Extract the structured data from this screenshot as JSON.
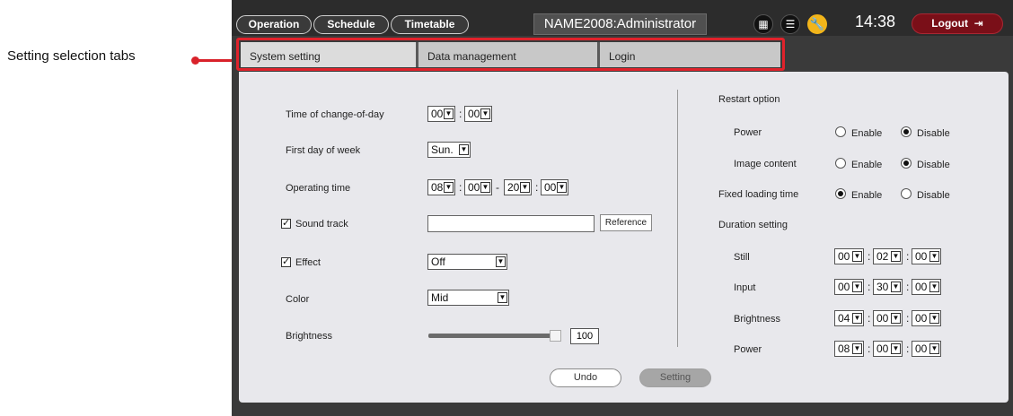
{
  "annotation": "Setting selection tabs",
  "nav": {
    "operation": "Operation",
    "schedule": "Schedule",
    "timetable": "Timetable"
  },
  "session_label": "NAME2008:Administrator",
  "clock": "14:38",
  "logout_label": "Logout",
  "tabs": [
    {
      "label": "System setting",
      "active": true
    },
    {
      "label": "Data management",
      "active": false
    },
    {
      "label": "Login",
      "active": false
    }
  ],
  "left": {
    "change_of_day": {
      "label": "Time of change-of-day",
      "hour": "00",
      "minute": "00"
    },
    "first_day": {
      "label": "First day of week",
      "value": "Sun."
    },
    "operating_time": {
      "label": "Operating time",
      "start_h": "08",
      "start_m": "00",
      "dash": "-",
      "end_h": "20",
      "end_m": "00"
    },
    "sound_track": {
      "label": "Sound track",
      "checked": true,
      "value": "",
      "reference_label": "Reference"
    },
    "effect": {
      "label": "Effect",
      "checked": true,
      "value": "Off"
    },
    "color": {
      "label": "Color",
      "value": "Mid"
    },
    "brightness": {
      "label": "Brightness",
      "value": "100",
      "level_percent": 100
    }
  },
  "right": {
    "restart_option": {
      "label": "Restart option"
    },
    "power": {
      "label": "Power",
      "selected": "Disable"
    },
    "image_content": {
      "label": "Image content",
      "selected": "Disable"
    },
    "fixed_loading_time": {
      "label": "Fixed loading time",
      "selected": "Enable"
    },
    "enable_label": "Enable",
    "disable_label": "Disable",
    "duration_setting": {
      "label": "Duration setting"
    },
    "durations": [
      {
        "label": "Still",
        "h": "00",
        "m": "02",
        "s": "00"
      },
      {
        "label": "Input",
        "h": "00",
        "m": "30",
        "s": "00"
      },
      {
        "label": "Brightness",
        "h": "04",
        "m": "00",
        "s": "00"
      },
      {
        "label": "Power",
        "h": "08",
        "m": "00",
        "s": "00"
      }
    ]
  },
  "actions": {
    "undo": "Undo",
    "setting": "Setting"
  },
  "colors": {
    "accent_red": "#e0222b",
    "logout_bg": "#7a0f18",
    "wrench": "#f2b51a",
    "panel": "#e8e8ec"
  },
  "icons": {
    "calendar": "calendar-icon",
    "list": "list-icon",
    "wrench": "wrench-icon",
    "logout": "logout-icon",
    "check": "check-icon"
  }
}
